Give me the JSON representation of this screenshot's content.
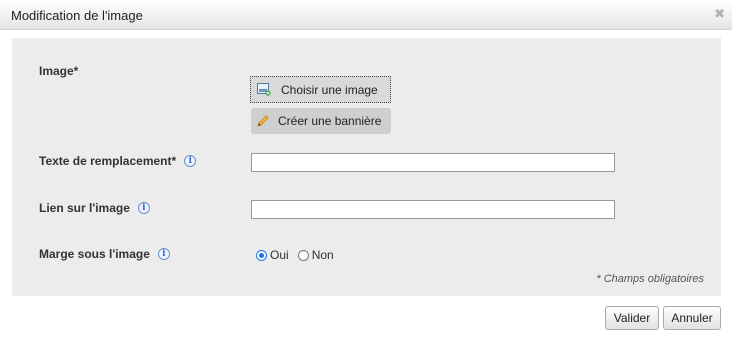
{
  "dialog": {
    "title": "Modification de l'image",
    "close_icon": "close-icon"
  },
  "form": {
    "image_label": "Image*",
    "choose_image_label": "Choisir une image",
    "create_banner_label": "Créer une bannière",
    "alt_text_label": "Texte de remplacement*",
    "alt_text_value": "",
    "link_label": "Lien sur l'image",
    "link_value": "",
    "margin_label": "Marge sous l'image",
    "margin_options": [
      {
        "label": "Oui",
        "selected": true
      },
      {
        "label": "Non",
        "selected": false
      }
    ],
    "required_note": "* Champs obligatoires"
  },
  "footer": {
    "validate_label": "Valider",
    "cancel_label": "Annuler"
  },
  "colors": {
    "accent": "#1a73e8",
    "panel_bg": "#ececec"
  }
}
